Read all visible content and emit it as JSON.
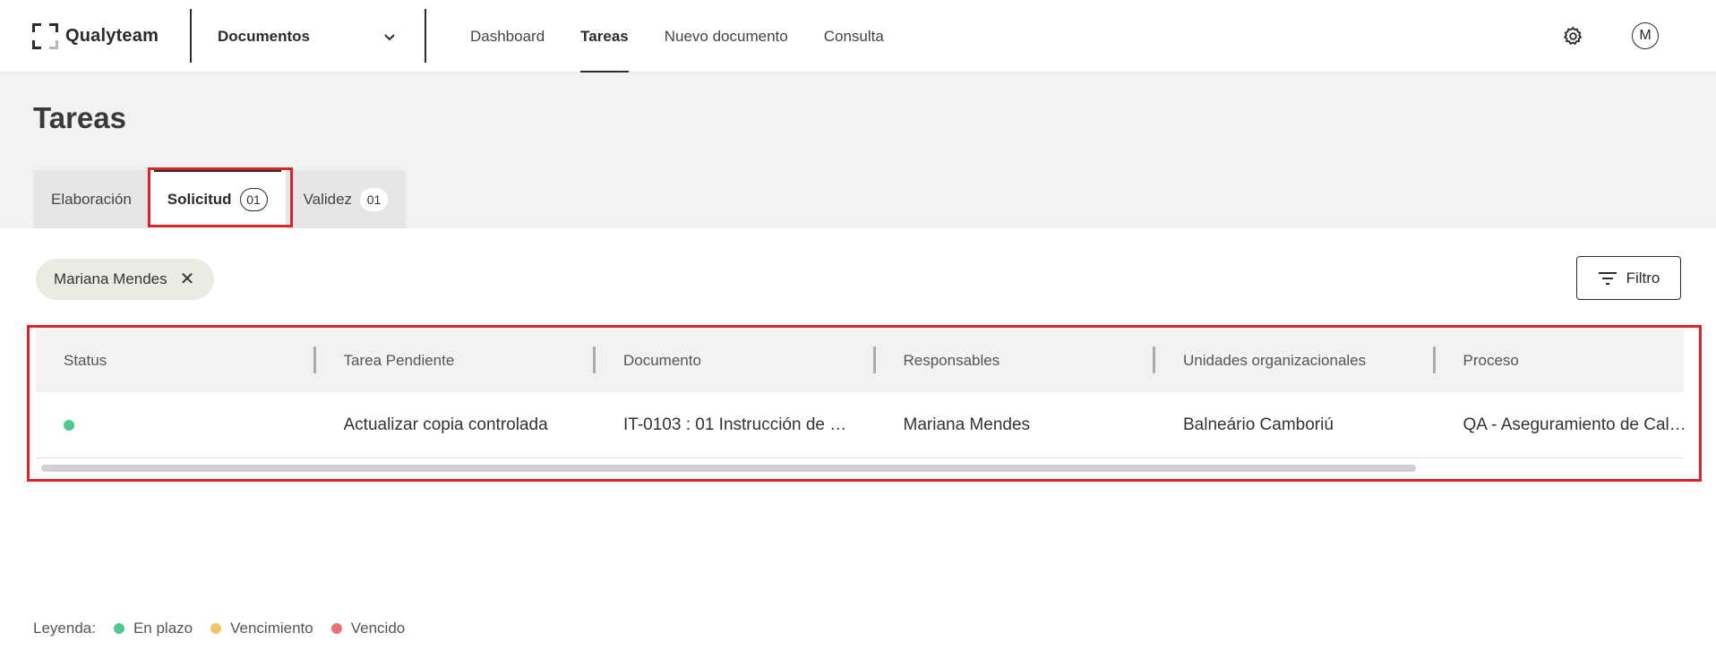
{
  "brand": {
    "name": "Qualyteam"
  },
  "module": {
    "label": "Documentos"
  },
  "nav": [
    {
      "label": "Dashboard"
    },
    {
      "label": "Tareas"
    },
    {
      "label": "Nuevo documento"
    },
    {
      "label": "Consulta"
    }
  ],
  "user": {
    "initial": "M"
  },
  "page": {
    "title": "Tareas"
  },
  "tabs": [
    {
      "label": "Elaboración",
      "count": ""
    },
    {
      "label": "Solicitud",
      "count": "01"
    },
    {
      "label": "Validez",
      "count": "01"
    }
  ],
  "active_tab": "Solicitud",
  "filter_chip": {
    "label": "Mariana Mendes"
  },
  "filter_button": {
    "label": "Filtro"
  },
  "table": {
    "columns": [
      "Status",
      "Tarea Pendiente",
      "Documento",
      "Responsables",
      "Unidades organizacionales",
      "Proceso"
    ],
    "rows": [
      {
        "status": "En plazo",
        "tarea": "Actualizar copia controlada",
        "documento": "IT-0103 : 01 Instrucción de …",
        "responsables": "Mariana Mendes",
        "unidades": "Balneário Camboriú",
        "proceso": "QA - Aseguramiento de Cal…"
      }
    ]
  },
  "legend": {
    "label": "Leyenda:",
    "items": [
      {
        "label": "En plazo",
        "color": "#4fc98e"
      },
      {
        "label": "Vencimiento",
        "color": "#f2c46a"
      },
      {
        "label": "Vencido",
        "color": "#e57373"
      }
    ]
  },
  "colors": {
    "highlight": "#d9252a",
    "status_ok": "#4fc98e"
  },
  "icons": {
    "settings": "gear-icon",
    "dropdown": "chevron-down-icon",
    "filter": "filter-icon",
    "remove": "close-icon"
  }
}
